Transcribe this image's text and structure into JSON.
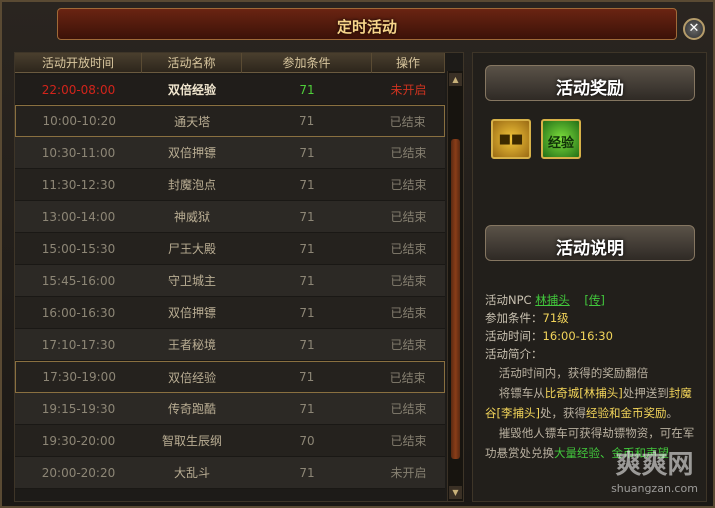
{
  "window": {
    "title": "定时活动",
    "close_icon": "close-icon"
  },
  "table": {
    "headers": [
      "活动开放时间",
      "活动名称",
      "参加条件",
      "操作"
    ],
    "rows": [
      {
        "time": "22:00-08:00",
        "name": "双倍经验",
        "condition": "71",
        "status": "未开启"
      },
      {
        "time": "10:00-10:20",
        "name": "通天塔",
        "condition": "71",
        "status": "已结束"
      },
      {
        "time": "10:30-11:00",
        "name": "双倍押镖",
        "condition": "71",
        "status": "已结束"
      },
      {
        "time": "11:30-12:30",
        "name": "封魔泡点",
        "condition": "71",
        "status": "已结束"
      },
      {
        "time": "13:00-14:00",
        "name": "神威狱",
        "condition": "71",
        "status": "已结束"
      },
      {
        "time": "15:00-15:30",
        "name": "尸王大殿",
        "condition": "71",
        "status": "已结束"
      },
      {
        "time": "15:45-16:00",
        "name": "守卫城主",
        "condition": "71",
        "status": "已结束"
      },
      {
        "time": "16:00-16:30",
        "name": "双倍押镖",
        "condition": "71",
        "status": "已结束"
      },
      {
        "time": "17:10-17:30",
        "name": "王者秘境",
        "condition": "71",
        "status": "已结束"
      },
      {
        "time": "17:30-19:00",
        "name": "双倍经验",
        "condition": "71",
        "status": "已结束"
      },
      {
        "time": "19:15-19:30",
        "name": "传奇跑酷",
        "condition": "71",
        "status": "已结束"
      },
      {
        "time": "19:30-20:00",
        "name": "智取生辰纲",
        "condition": "70",
        "status": "已结束"
      },
      {
        "time": "20:00-20:20",
        "name": "大乱斗",
        "condition": "71",
        "status": "未开启"
      }
    ]
  },
  "side": {
    "reward_title": "活动奖励",
    "reward_icons": [
      "gold-coin-icon",
      "exp-icon"
    ],
    "reward_exp_text": "经验",
    "desc_title": "活动说明",
    "npc_label": "活动NPC",
    "npc_name": "林捕头",
    "npc_link": "[传]",
    "cond_label": "参加条件：",
    "cond_value": "71级",
    "time_label": "活动时间：",
    "time_value": "16:00-16:30",
    "intro_label": "活动简介：",
    "intro_highlight": "活动时间内，获得的奖励翻倍",
    "para1_a": "将镖车从",
    "para1_b": "比奇城[林捕头]",
    "para1_c": "处押送到",
    "para1_d": "封魔谷[李捕头]",
    "para1_e": "处，获得",
    "para1_f": "经验和金币奖励",
    "para1_g": "。",
    "para2_a": "摧毁他人镖车可获得劫镖物资，可在军功悬赏处兑换",
    "para2_b": "大量经验、金币和声望"
  },
  "watermark": {
    "big": "爽爽网",
    "small": "shuangzan.com"
  }
}
